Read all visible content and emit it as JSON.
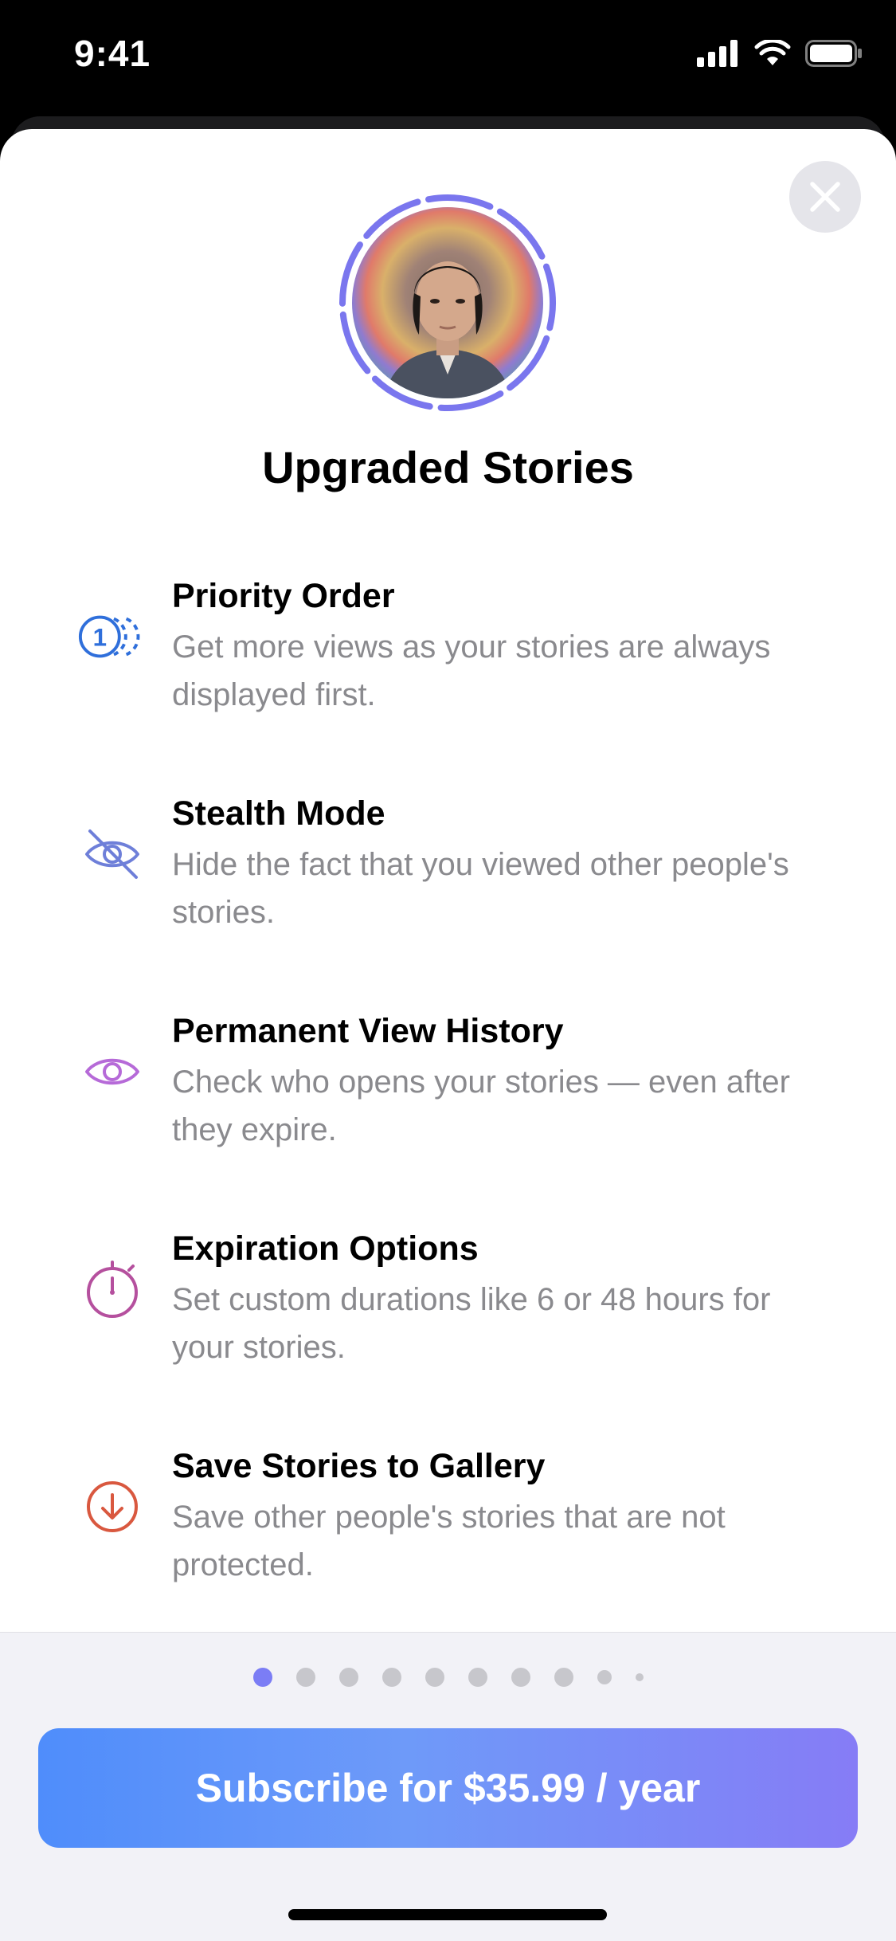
{
  "status_bar": {
    "time": "9:41"
  },
  "sheet": {
    "title": "Upgraded Stories",
    "features": [
      {
        "title": "Priority Order",
        "description": "Get more views as your stories are always displayed first.",
        "icon": "priority-order-icon",
        "color": "#2f6fdb"
      },
      {
        "title": "Stealth Mode",
        "description": "Hide the fact that you viewed other people's stories.",
        "icon": "eye-slash-icon",
        "color": "#6e7fd9"
      },
      {
        "title": "Permanent View History",
        "description": "Check who opens your stories — even after they expire.",
        "icon": "eye-icon",
        "color": "#b66ad8"
      },
      {
        "title": "Expiration Options",
        "description": "Set custom durations like 6 or 48 hours for your stories.",
        "icon": "stopwatch-icon",
        "color": "#b5509e"
      },
      {
        "title": "Save Stories to Gallery",
        "description": "Save other people's stories that are not protected.",
        "icon": "download-circle-icon",
        "color": "#d9583f"
      }
    ]
  },
  "pagination": {
    "total": 10,
    "active_index": 0
  },
  "subscribe_button": {
    "label": "Subscribe for $35.99 / year"
  },
  "colors": {
    "accent": "#7b7df5",
    "active_dot": "#7b7df5",
    "button_start": "#4f8dfb",
    "button_end": "#867cf6"
  }
}
